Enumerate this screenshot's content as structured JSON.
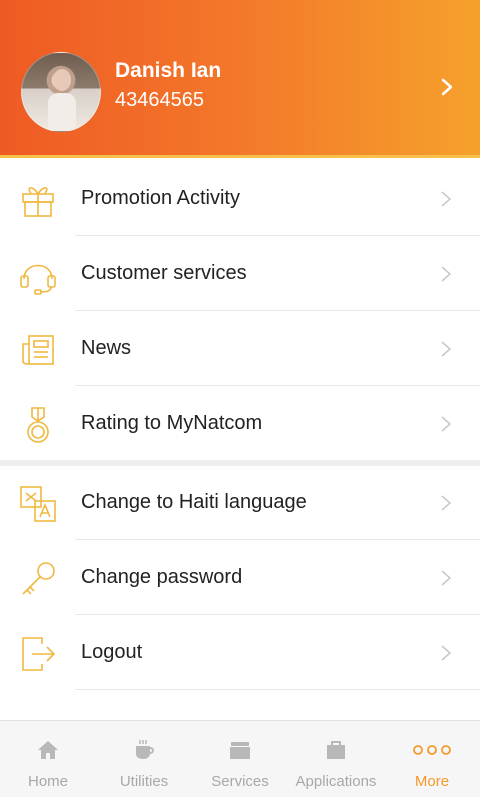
{
  "profile": {
    "name": "Danish Ian",
    "number": "43464565"
  },
  "menu": {
    "promotion": "Promotion Activity",
    "customer_services": "Customer services",
    "news": "News",
    "rating": "Rating to MyNatcom",
    "language": "Change to Haiti language",
    "password": "Change password",
    "logout": "Logout"
  },
  "tabs": {
    "home": "Home",
    "utilities": "Utilities",
    "services": "Services",
    "applications": "Applications",
    "more": "More"
  },
  "colors": {
    "accent": "#f39a2a",
    "header_start": "#ef5a24",
    "header_end": "#f6a12c",
    "icon": "#f0b840"
  }
}
